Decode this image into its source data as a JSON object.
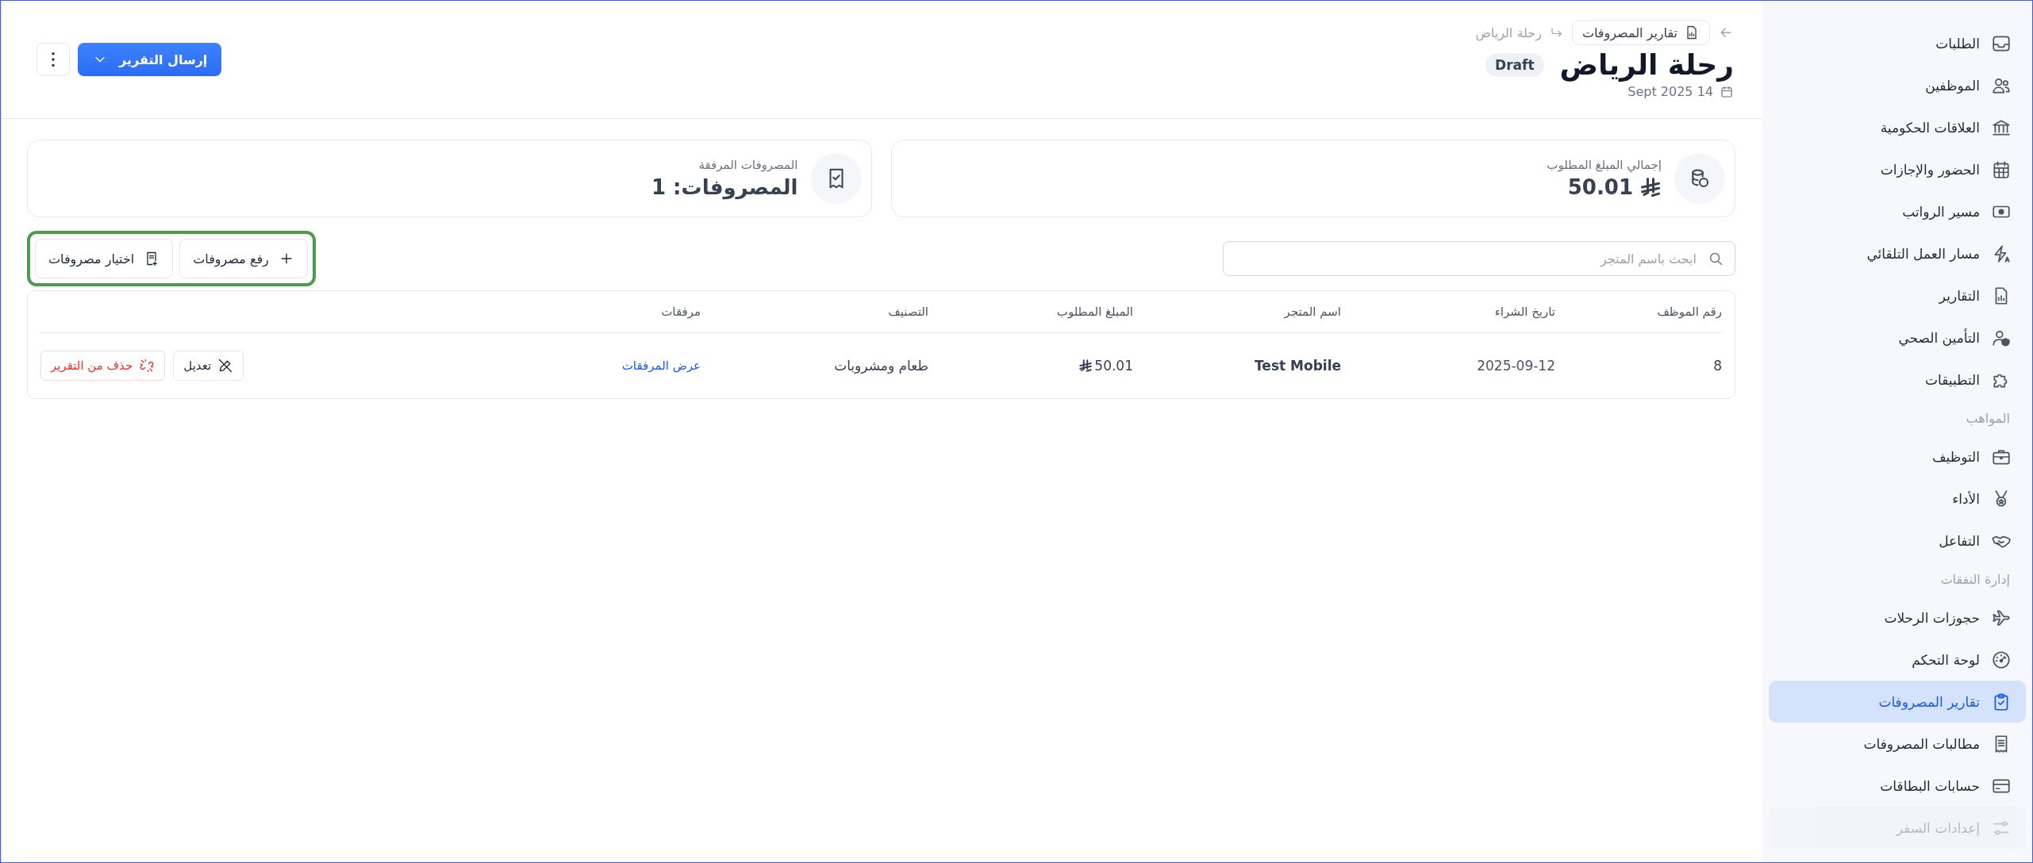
{
  "breadcrumb": {
    "parent": "تقارير المصروفات",
    "current": "رحلة الرياض"
  },
  "header": {
    "title": "رحلة الرياض",
    "status": "Draft",
    "date": "Sept 2025 14",
    "primary_action": "إرسال التقرير"
  },
  "summary": [
    {
      "kind": "amount",
      "label": "إجمالي المبلغ المطلوب",
      "value": "50.01"
    },
    {
      "kind": "count",
      "label": "المصروفات المرفقة",
      "value": "المصروفات: 1"
    }
  ],
  "toolbar": {
    "search": {
      "placeholder": "ابحث باسم المتجر"
    },
    "buttons": [
      {
        "kind": "upload",
        "label": "رفع مصروفات"
      },
      {
        "kind": "select",
        "label": "اختيار مصروفات"
      }
    ]
  },
  "table": {
    "columns": [
      "رقم الموظف",
      "تاريخ الشراء",
      "اسم المتجر",
      "المبلغ المطلوب",
      "التصنيف",
      "مرفقات"
    ],
    "rows": [
      {
        "employee_id": "8",
        "purchase_date": "2025-09-12",
        "merchant": "Test Mobile",
        "amount": "50.01",
        "category": "طعام ومشروبات",
        "attachments": "عرض المرفقات",
        "edit": "تعديل",
        "remove": "حذف من التقرير"
      }
    ]
  },
  "sidebar": {
    "items": [
      {
        "kind": "item",
        "label": "الطلبات",
        "selected": false,
        "faded": false
      },
      {
        "kind": "item",
        "label": "الموظفين",
        "selected": false,
        "faded": false
      },
      {
        "kind": "item",
        "label": "العلاقات الحكومية",
        "selected": false,
        "faded": false
      },
      {
        "kind": "item",
        "label": "الحضور والإجازات",
        "selected": false,
        "faded": false
      },
      {
        "kind": "item",
        "label": "مسير الرواتب",
        "selected": false,
        "faded": false
      },
      {
        "kind": "item",
        "label": "مسار العمل التلقائي",
        "selected": false,
        "faded": false
      },
      {
        "kind": "item",
        "label": "التقارير",
        "selected": false,
        "faded": false
      },
      {
        "kind": "item",
        "label": "التأمين الصحي",
        "selected": false,
        "faded": false
      },
      {
        "kind": "item",
        "label": "التطبيقات",
        "selected": false,
        "faded": false
      },
      {
        "kind": "section",
        "label": "المواهب"
      },
      {
        "kind": "item",
        "label": "التوظيف",
        "selected": false,
        "faded": false
      },
      {
        "kind": "item",
        "label": "الأداء",
        "selected": false,
        "faded": false
      },
      {
        "kind": "item",
        "label": "التفاعل",
        "selected": false,
        "faded": false
      },
      {
        "kind": "section",
        "label": "إدارة النفقات"
      },
      {
        "kind": "item",
        "label": "حجوزات الرحلات",
        "selected": false,
        "faded": false
      },
      {
        "kind": "item",
        "label": "لوحة التحكم",
        "selected": false,
        "faded": false
      },
      {
        "kind": "item",
        "label": "تقارير المصروفات",
        "selected": true,
        "faded": false
      },
      {
        "kind": "item",
        "label": "مطالبات المصروفات",
        "selected": false,
        "faded": false
      },
      {
        "kind": "item",
        "label": "حسابات البطاقات",
        "selected": false,
        "faded": false
      },
      {
        "kind": "item",
        "label": "إعدادات السفر",
        "selected": false,
        "faded": true
      }
    ]
  }
}
